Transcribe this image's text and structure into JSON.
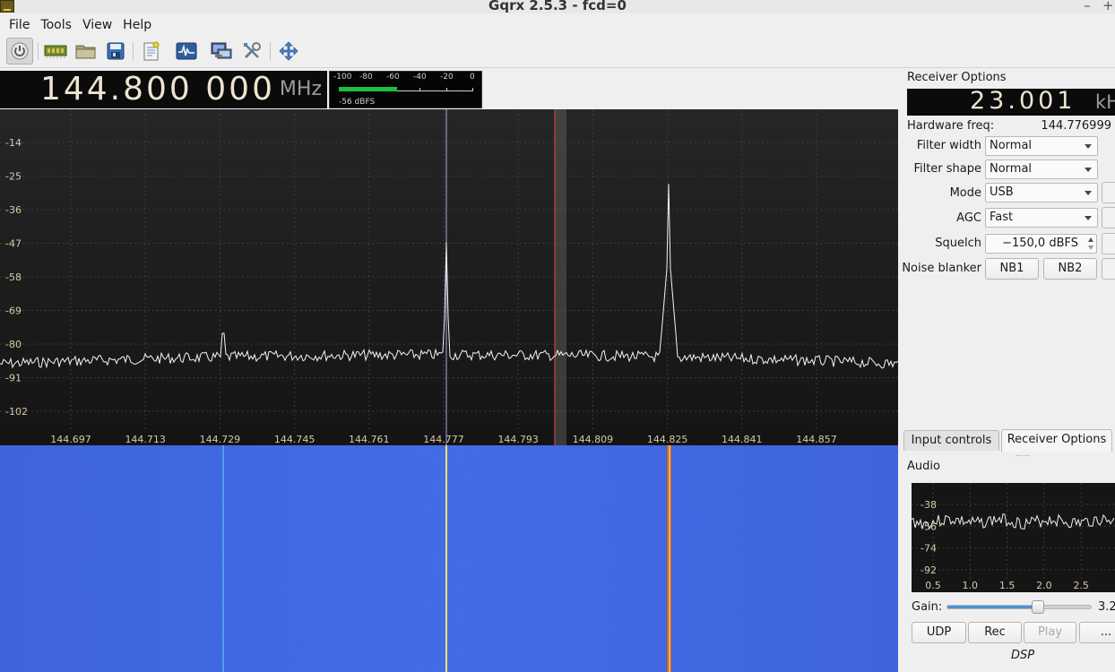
{
  "window": {
    "title": "Gqrx 2.5.3 - fcd=0",
    "minimize": "–",
    "maximize": "+"
  },
  "menu": [
    {
      "label": "File"
    },
    {
      "label": "Tools"
    },
    {
      "label": "View"
    },
    {
      "label": "Help"
    }
  ],
  "toolbar_icons": [
    "power-icon",
    "hardware-icon",
    "open-folder-icon",
    "save-icon",
    "notes-icon",
    "spectrum-icon",
    "remote-control-icon",
    "settings-tools-icon",
    "fullscreen-icon"
  ],
  "frequency": {
    "value": "144.800 000",
    "unit": "MHz"
  },
  "signal_meter": {
    "scale": [
      "-100",
      "-80",
      "-60",
      "-40",
      "-20",
      "0"
    ],
    "level_fraction": 0.43,
    "reading": "-56 dBFS",
    "bar_color": "#1fbf3c"
  },
  "spectrum": {
    "y_ticks": [
      "-14",
      "-25",
      "-36",
      "-47",
      "-58",
      "-69",
      "-80",
      "-91",
      "-102"
    ],
    "x_ticks": [
      "144.697",
      "144.713",
      "144.729",
      "144.745",
      "144.761",
      "144.777",
      "144.793",
      "144.809",
      "144.825",
      "144.841",
      "144.857"
    ],
    "tuned_marker_color": "#d04040",
    "center_marker_color": "#b0a8d8"
  },
  "receiver": {
    "title": "Receiver Options",
    "offset": {
      "value": "23.001",
      "unit": "kH"
    },
    "hardware_freq_label": "Hardware freq:",
    "hardware_freq_value": "144.776999",
    "filter_width_label": "Filter width",
    "filter_width": "Normal",
    "filter_shape_label": "Filter shape",
    "filter_shape": "Normal",
    "mode_label": "Mode",
    "mode": "USB",
    "agc_label": "AGC",
    "agc": "Fast",
    "squelch_label": "Squelch",
    "squelch": "−150,0 dBFS",
    "noise_blanker_label": "Noise blanker",
    "nb1": "NB1",
    "nb2": "NB2"
  },
  "tabs": [
    {
      "label": "Input controls",
      "active": false
    },
    {
      "label": "Receiver Options",
      "active": true
    }
  ],
  "audio": {
    "title": "Audio",
    "y_ticks": [
      "-38",
      "-56",
      "-74",
      "-92"
    ],
    "x_ticks": [
      "0.5",
      "1.0",
      "1.5",
      "2.0",
      "2.5"
    ],
    "gain_label": "Gain:",
    "gain_value": "3.2",
    "gain_fraction": 0.63,
    "udp": "UDP",
    "rec": "Rec",
    "play": "Play",
    "more": "...",
    "dsp_label": "DSP"
  }
}
